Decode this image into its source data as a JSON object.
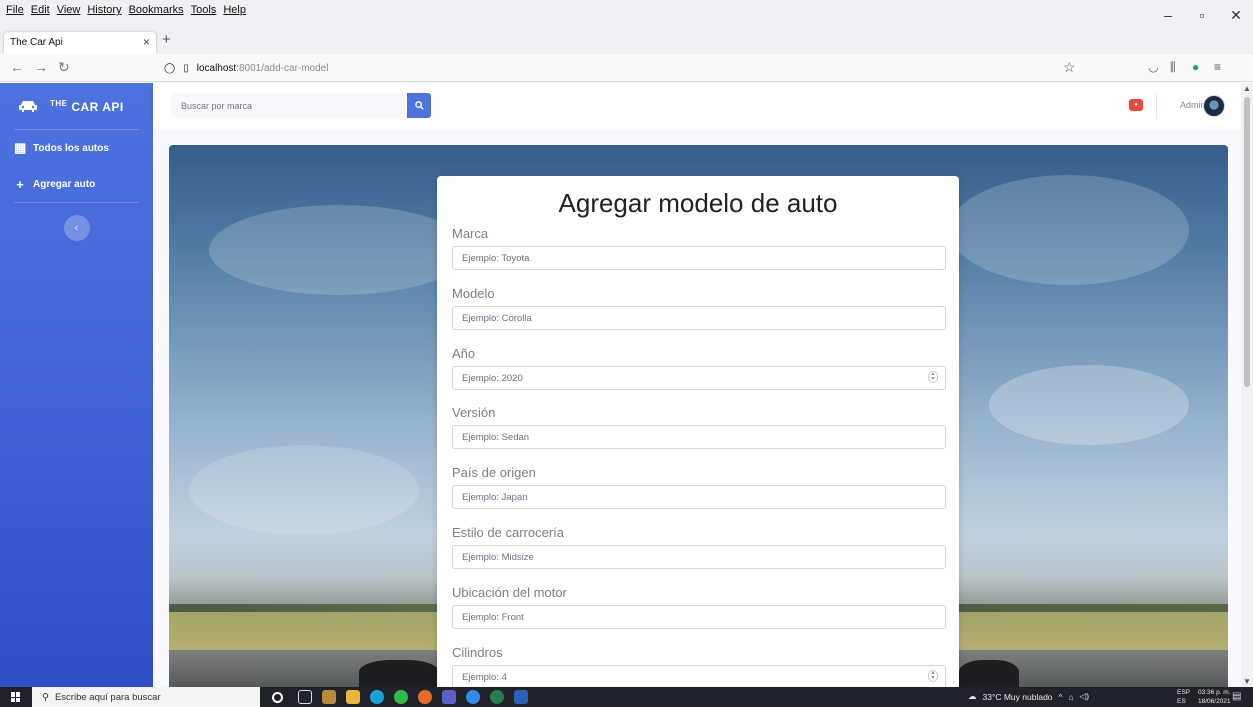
{
  "browser": {
    "menu": [
      "File",
      "Edit",
      "View",
      "History",
      "Bookmarks",
      "Tools",
      "Help"
    ],
    "tab_title": "The Car Api",
    "url_host": "localhost",
    "url_path": ":8001/add-car-model"
  },
  "sidebar": {
    "brand_prefix": "THE",
    "brand_name": "CAR API",
    "items": [
      {
        "label": "Todos los autos",
        "icon": "table-icon"
      },
      {
        "label": "Agregar auto",
        "icon": "plus-icon"
      }
    ]
  },
  "topbar": {
    "search_placeholder": "Buscar por marca",
    "user_name": "Admin"
  },
  "form": {
    "title": "Agregar modelo de auto",
    "fields": [
      {
        "label": "Marca",
        "placeholder": "Ejemplo: Toyota",
        "type": "text"
      },
      {
        "label": "Modelo",
        "placeholder": "Ejemplo: Corolla",
        "type": "text"
      },
      {
        "label": "Año",
        "placeholder": "Ejemplo: 2020",
        "type": "number"
      },
      {
        "label": "Versión",
        "placeholder": "Ejemplo: Sedan",
        "type": "text"
      },
      {
        "label": "País de origen",
        "placeholder": "Ejemplo: Japan",
        "type": "text"
      },
      {
        "label": "Estilo de carrocería",
        "placeholder": "Ejemplo: Midsize",
        "type": "text"
      },
      {
        "label": "Ubicación del motor",
        "placeholder": "Ejemplo: Front",
        "type": "text"
      },
      {
        "label": "Cilindros",
        "placeholder": "Ejemplo: 4",
        "type": "number"
      }
    ]
  },
  "taskbar": {
    "search_text": "Escribe aquí para buscar",
    "weather": "33°C  Muy nublado",
    "lang_top": "ESP",
    "lang_bottom": "ES",
    "time": "03:36 p. m.",
    "date": "18/06/2021"
  },
  "colors": {
    "sidebar": "#4e73df",
    "accent": "#4e73df",
    "alert": "#e74a3b"
  }
}
